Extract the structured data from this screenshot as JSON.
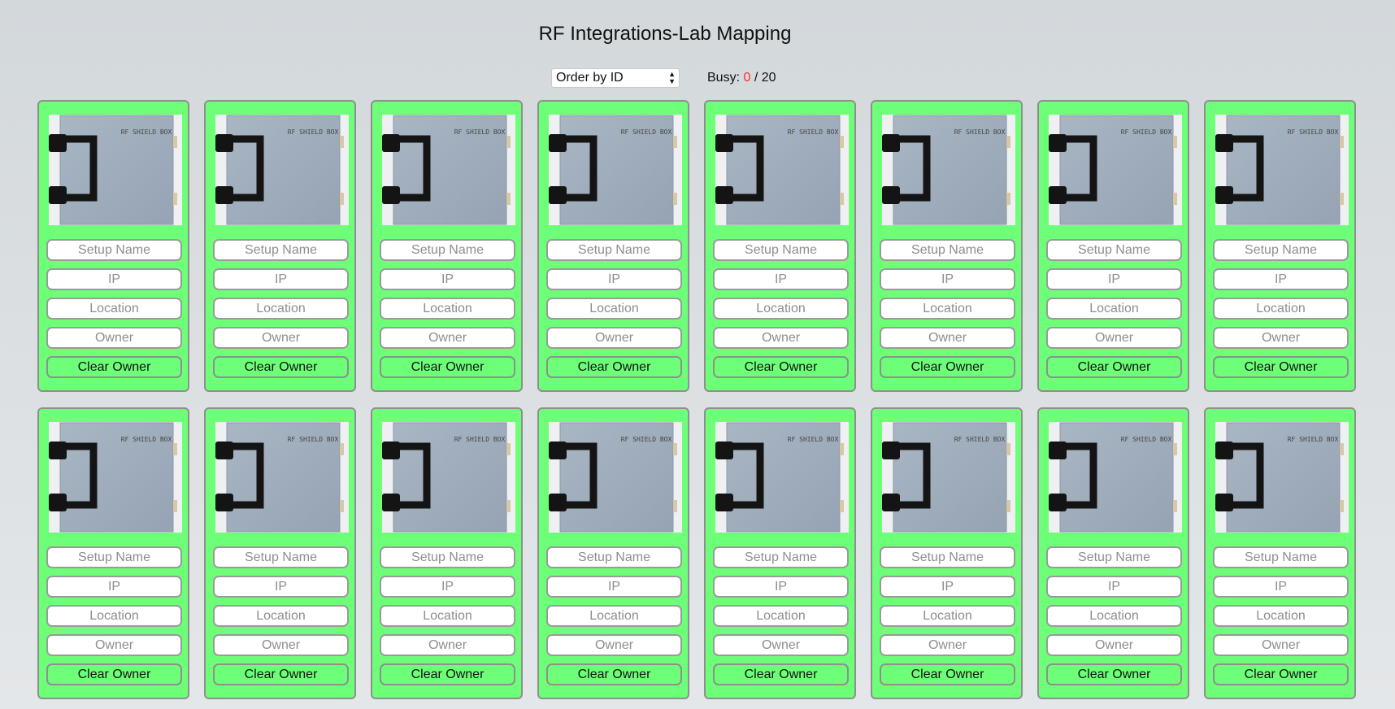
{
  "page": {
    "title": "RF Integrations-Lab Mapping"
  },
  "controls": {
    "order_select": "Order by ID",
    "busy_label": "Busy:",
    "busy_count": "0",
    "busy_separator": "/",
    "busy_total": "20"
  },
  "card": {
    "image_text": "RF SHIELD BOX",
    "setup_placeholder": "Setup Name",
    "ip_placeholder": "IP",
    "location_placeholder": "Location",
    "owner_placeholder": "Owner",
    "clear_label": "Clear Owner"
  },
  "colors": {
    "card_free": "#6dff78",
    "busy_count": "#ff2a2a"
  },
  "icons": {
    "select_arrows": "up-down-chevron-icon"
  }
}
